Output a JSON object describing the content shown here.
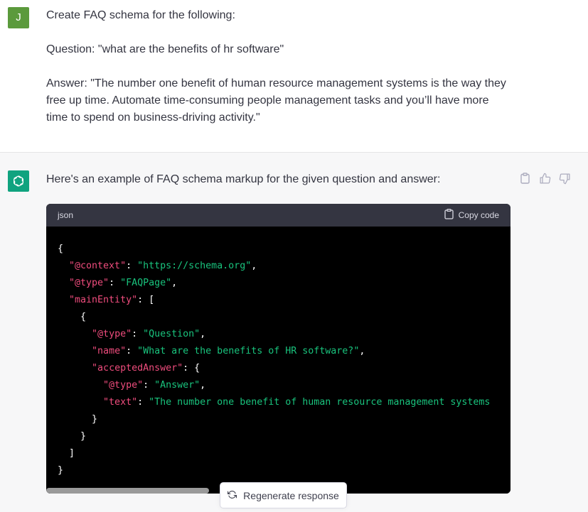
{
  "user": {
    "avatar_letter": "J",
    "paragraphs": [
      "Create FAQ schema for the following:",
      "Question: \"what are the benefits of hr software\"",
      "Answer: \"The number one benefit of human resource management systems is the way they free up time. Automate time-consuming people management tasks and you’ll have more time to spend on business-driving activity.\""
    ]
  },
  "assistant": {
    "intro": "Here's an example of FAQ schema markup for the given question and answer:",
    "code_block": {
      "language": "json",
      "copy_label": "Copy code",
      "lines": [
        [
          {
            "t": "{",
            "c": "punc"
          }
        ],
        [
          {
            "t": "  ",
            "c": "punc"
          },
          {
            "t": "\"@context\"",
            "c": "key"
          },
          {
            "t": ": ",
            "c": "punc"
          },
          {
            "t": "\"https://schema.org\"",
            "c": "str"
          },
          {
            "t": ",",
            "c": "punc"
          }
        ],
        [
          {
            "t": "  ",
            "c": "punc"
          },
          {
            "t": "\"@type\"",
            "c": "key"
          },
          {
            "t": ": ",
            "c": "punc"
          },
          {
            "t": "\"FAQPage\"",
            "c": "str"
          },
          {
            "t": ",",
            "c": "punc"
          }
        ],
        [
          {
            "t": "  ",
            "c": "punc"
          },
          {
            "t": "\"mainEntity\"",
            "c": "key"
          },
          {
            "t": ": [",
            "c": "punc"
          }
        ],
        [
          {
            "t": "    {",
            "c": "punc"
          }
        ],
        [
          {
            "t": "      ",
            "c": "punc"
          },
          {
            "t": "\"@type\"",
            "c": "key"
          },
          {
            "t": ": ",
            "c": "punc"
          },
          {
            "t": "\"Question\"",
            "c": "str"
          },
          {
            "t": ",",
            "c": "punc"
          }
        ],
        [
          {
            "t": "      ",
            "c": "punc"
          },
          {
            "t": "\"name\"",
            "c": "key"
          },
          {
            "t": ": ",
            "c": "punc"
          },
          {
            "t": "\"What are the benefits of HR software?\"",
            "c": "str"
          },
          {
            "t": ",",
            "c": "punc"
          }
        ],
        [
          {
            "t": "      ",
            "c": "punc"
          },
          {
            "t": "\"acceptedAnswer\"",
            "c": "key"
          },
          {
            "t": ": {",
            "c": "punc"
          }
        ],
        [
          {
            "t": "        ",
            "c": "punc"
          },
          {
            "t": "\"@type\"",
            "c": "key"
          },
          {
            "t": ": ",
            "c": "punc"
          },
          {
            "t": "\"Answer\"",
            "c": "str"
          },
          {
            "t": ",",
            "c": "punc"
          }
        ],
        [
          {
            "t": "        ",
            "c": "punc"
          },
          {
            "t": "\"text\"",
            "c": "key"
          },
          {
            "t": ": ",
            "c": "punc"
          },
          {
            "t": "\"The number one benefit of human resource management systems",
            "c": "str"
          }
        ],
        [
          {
            "t": "      }",
            "c": "punc"
          }
        ],
        [
          {
            "t": "    }",
            "c": "punc"
          }
        ],
        [
          {
            "t": "  ]",
            "c": "punc"
          }
        ],
        [
          {
            "t": "}",
            "c": "punc"
          }
        ]
      ]
    },
    "scroll_fraction_visible": 0.35
  },
  "regenerate_label": "Regenerate response",
  "icons": {
    "assistant_avatar": "openai-logo-icon",
    "copy": "clipboard-icon",
    "thumbs_up": "thumbs-up-icon",
    "thumbs_down": "thumbs-down-icon",
    "regenerate": "refresh-icon"
  },
  "colors": {
    "user_avatar": "#5b9a3c",
    "assistant_avatar": "#10a37f",
    "code_bg": "#000000",
    "code_header_bg": "#343541",
    "json_key": "#ef4c7d",
    "json_string": "#19c37d",
    "assistant_bg": "#f7f7f8"
  }
}
